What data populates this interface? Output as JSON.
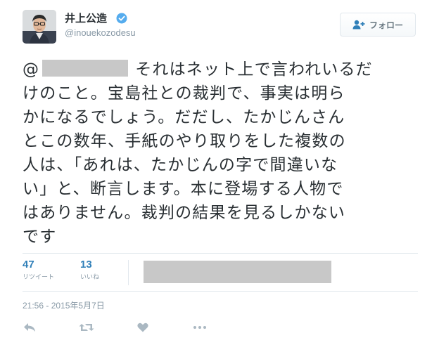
{
  "user": {
    "display_name": "井上公造",
    "screen_name": "@inouekozodesu",
    "verified": true
  },
  "follow_button": {
    "label": "フォロー",
    "icon": "add-user-icon"
  },
  "tweet": {
    "mention_redacted": true,
    "lines": [
      "それはネット上で言われいるだ",
      "けのこと。宝島社との裁判で、事実は明ら",
      "かになるでしょう。だだし、たかじんさん",
      "とこの数年、手紙のやり取りをした複数の",
      "人は、「あれは、たかじんの字で間違いな",
      "い」と、断言します。本に登場する人物で",
      "はありません。裁判の結果を見るしかない",
      "です"
    ],
    "line_prefix": "@"
  },
  "stats": {
    "retweets": {
      "value": "47",
      "label": "リツイート"
    },
    "likes": {
      "value": "13",
      "label": "いいね"
    }
  },
  "timestamp": "21:56 - 2015年5月7日",
  "actions": [
    {
      "name": "reply-icon"
    },
    {
      "name": "retweet-icon"
    },
    {
      "name": "like-icon"
    },
    {
      "name": "more-icon"
    }
  ],
  "colors": {
    "accent": "#2f7fb8",
    "verified": "#55acee",
    "muted": "#8899a6",
    "text": "#292f33",
    "redaction": "#c8c8c8"
  }
}
